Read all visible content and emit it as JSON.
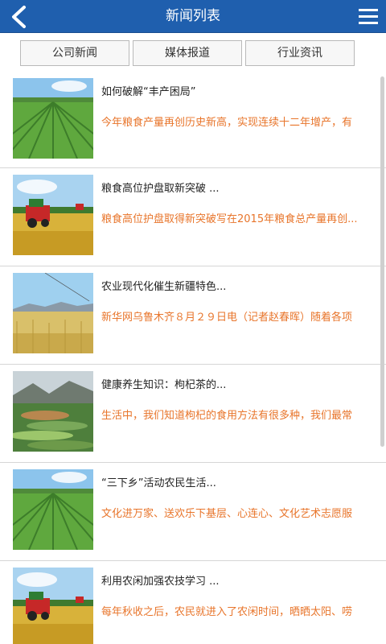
{
  "header": {
    "title": "新闻列表",
    "back_icon": "back-arrow-icon",
    "menu_icon": "hamburger-menu-icon",
    "bar_color": "#1f5fae"
  },
  "tabs": [
    {
      "label": "公司新闻"
    },
    {
      "label": "媒体报道"
    },
    {
      "label": "行业资讯"
    }
  ],
  "news": [
    {
      "title": "如何破解“丰产困局”",
      "summary": "今年粮食产量再创历史新高，实现连续十二年增产，有",
      "image": "green-field"
    },
    {
      "title": "粮食高位护盘取新突破 ...",
      "summary": "粮食高位护盘取得新突破写在2015年粮食总产量再创...",
      "image": "harvester"
    },
    {
      "title": "农业现代化催生新疆特色...",
      "summary": "新华网乌鲁木齐８月２９日电（记者赵春晖）随着各项",
      "image": "wheat-field"
    },
    {
      "title": "健康养生知识：枸杞茶的...",
      "summary": "生活中，我们知道枸杞的食用方法有很多种，我们最常",
      "image": "terraces"
    },
    {
      "title": "“三下乡”活动农民生活...",
      "summary": "文化进万家、送欢乐下基层、心连心、文化艺术志愿服",
      "image": "green-field"
    },
    {
      "title": "利用农闲加强农技学习 ...",
      "summary": "每年秋收之后，农民就进入了农闲时间，晒晒太阳、唠",
      "image": "harvester"
    }
  ],
  "summary_color": "#e8752b"
}
